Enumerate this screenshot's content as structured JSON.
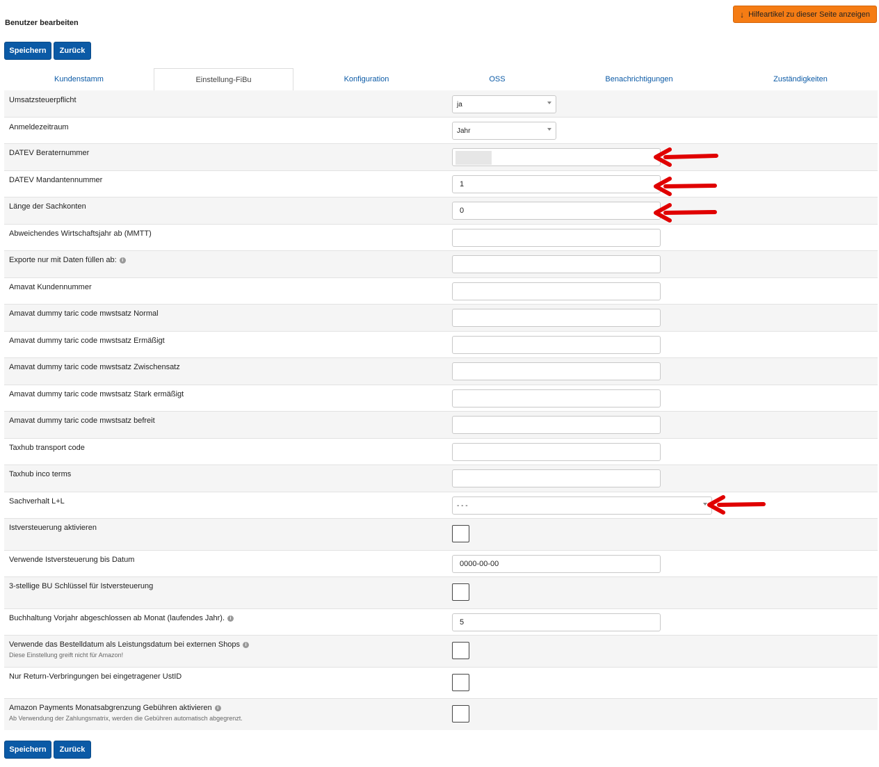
{
  "page": {
    "title": "Benutzer bearbeiten"
  },
  "help_button": {
    "label": "Hilfeartikel zu dieser Seite anzeigen",
    "icon": "arrow-down-icon"
  },
  "actions": {
    "save_label": "Speichern",
    "back_label": "Zurück"
  },
  "tabs": [
    {
      "label": "Kundenstamm",
      "active": false
    },
    {
      "label": "Einstellung-FiBu",
      "active": true
    },
    {
      "label": "Konfiguration",
      "active": false
    },
    {
      "label": "OSS",
      "active": false
    },
    {
      "label": "Benachrichtigungen",
      "active": false
    },
    {
      "label": "Zuständigkeiten",
      "active": false
    }
  ],
  "form": {
    "umsatzsteuerpflicht": {
      "label": "Umsatzsteuerpflicht",
      "value": "ja"
    },
    "anmeldezeitraum": {
      "label": "Anmeldezeitraum",
      "value": "Jahr"
    },
    "datev_berater": {
      "label": "DATEV Beraternummer",
      "value": ""
    },
    "datev_mandant": {
      "label": "DATEV Mandantennummer",
      "value": "1"
    },
    "sachkonten": {
      "label": "Länge der Sachkonten",
      "value": "0"
    },
    "wirtschaftsjahr": {
      "label": "Abweichendes Wirtschaftsjahr ab (MMTT)",
      "value": ""
    },
    "exporte": {
      "label": "Exporte nur mit Daten füllen ab:",
      "value": ""
    },
    "amavat_kunde": {
      "label": "Amavat Kundennummer",
      "value": ""
    },
    "amavat_normal": {
      "label": "Amavat dummy taric code mwstsatz Normal",
      "value": ""
    },
    "amavat_ermaessigt": {
      "label": "Amavat dummy taric code mwstsatz Ermäßigt",
      "value": ""
    },
    "amavat_zwischen": {
      "label": "Amavat dummy taric code mwstsatz Zwischensatz",
      "value": ""
    },
    "amavat_stark": {
      "label": "Amavat dummy taric code mwstsatz Stark ermäßigt",
      "value": ""
    },
    "amavat_befreit": {
      "label": "Amavat dummy taric code mwstsatz befreit",
      "value": ""
    },
    "taxhub_transport": {
      "label": "Taxhub transport code",
      "value": ""
    },
    "taxhub_inco": {
      "label": "Taxhub inco terms",
      "value": ""
    },
    "sachverhalt": {
      "label": "Sachverhalt L+L",
      "value": "- - -"
    },
    "istversteuerung": {
      "label": "Istversteuerung aktivieren",
      "checked": false
    },
    "istversteuerung_datum": {
      "label": "Verwende Istversteuerung bis Datum",
      "value": "0000-00-00"
    },
    "bu_schluessel": {
      "label": "3-stellige BU Schlüssel für Istversteuerung",
      "checked": false
    },
    "vorjahr": {
      "label": "Buchhaltung Vorjahr abgeschlossen ab Monat (laufendes Jahr).",
      "value": "5"
    },
    "bestelldatum": {
      "label": "Verwende das Bestelldatum als Leistungsdatum bei externen Shops",
      "hint": "Diese Einstellung greift nicht für Amazon!",
      "checked": false
    },
    "return": {
      "label": "Nur Return-Verbringungen bei eingetragener UstID",
      "checked": false
    },
    "amazon_payments": {
      "label": "Amazon Payments Monatsabgrenzung Gebühren aktivieren",
      "hint": "Ab Verwendung der Zahlungsmatrix, werden die Gebühren automatisch abgegrenzt.",
      "checked": false
    }
  },
  "colors": {
    "primary": "#0b5aa6",
    "help": "#f57c14",
    "annotation": "#e00000"
  }
}
